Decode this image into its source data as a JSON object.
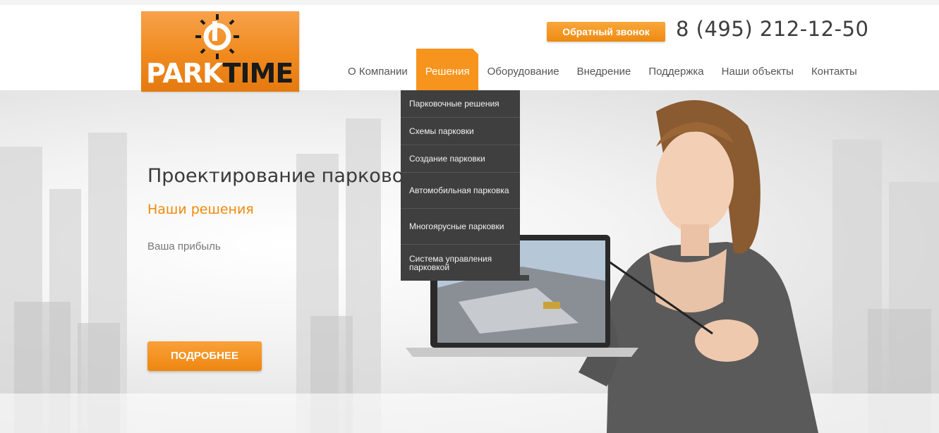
{
  "header": {
    "logo": {
      "part1": "PARK",
      "part2": "TIME"
    },
    "callback_label": "Обратный звонок",
    "phone": "8 (495) 212-12-50"
  },
  "nav": {
    "items": [
      {
        "label": "О Компании"
      },
      {
        "label": "Решения",
        "active": true
      },
      {
        "label": "Оборудование"
      },
      {
        "label": "Внедрение"
      },
      {
        "label": "Поддержка"
      },
      {
        "label": "Наши объекты"
      },
      {
        "label": "Контакты"
      }
    ]
  },
  "dropdown": {
    "items": [
      {
        "label": "Парковочные решения"
      },
      {
        "label": "Схемы парковки"
      },
      {
        "label": "Создание парковки"
      },
      {
        "label": "Автомобильная парковка"
      },
      {
        "label": "Многоярусные парковки"
      },
      {
        "label": "Система управления парковкой"
      }
    ]
  },
  "hero": {
    "title": "Проектирование парковок",
    "subtitle": "Наши решения",
    "text": "Ваша прибыль",
    "more_label": "ПОДРОБНЕЕ"
  },
  "colors": {
    "accent": "#f7941d",
    "dropdown_bg": "#3f3f3f",
    "title_text": "#3a3a3a"
  },
  "icons": {
    "logo_emblem": "parking-sun-emblem"
  }
}
